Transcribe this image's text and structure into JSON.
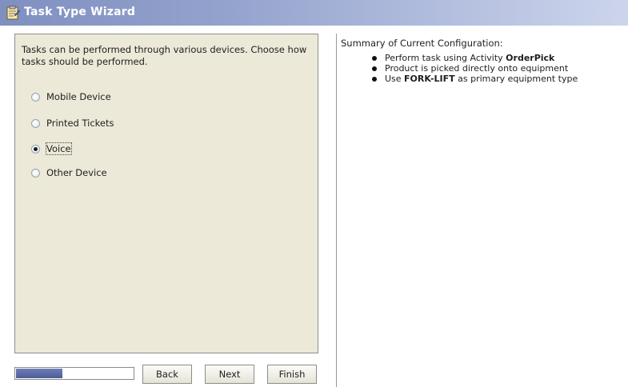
{
  "window": {
    "title": "Task Type Wizard",
    "icon": "wizard-clipboard-icon",
    "titlebar_color": "#8a99c8"
  },
  "left": {
    "instructions": "Tasks can be performed through various devices. Choose how tasks should be performed.",
    "options": [
      {
        "label": "Mobile Device",
        "selected": false
      },
      {
        "label": "Printed Tickets",
        "selected": false
      },
      {
        "label": "Voice",
        "selected": true
      },
      {
        "label": "Other Device",
        "selected": false
      }
    ]
  },
  "progress": {
    "fraction": 0.4
  },
  "buttons": {
    "back": "Back",
    "next": "Next",
    "finish": "Finish"
  },
  "summary": {
    "title": "Summary of Current Configuration:",
    "items": [
      {
        "prefix": "Perform task using Activity ",
        "bold": "OrderPick",
        "suffix": ""
      },
      {
        "prefix": "Product is picked directly onto equipment",
        "bold": "",
        "suffix": ""
      },
      {
        "prefix": "Use ",
        "bold": "FORK-LIFT",
        "suffix": " as primary equipment type"
      }
    ]
  }
}
